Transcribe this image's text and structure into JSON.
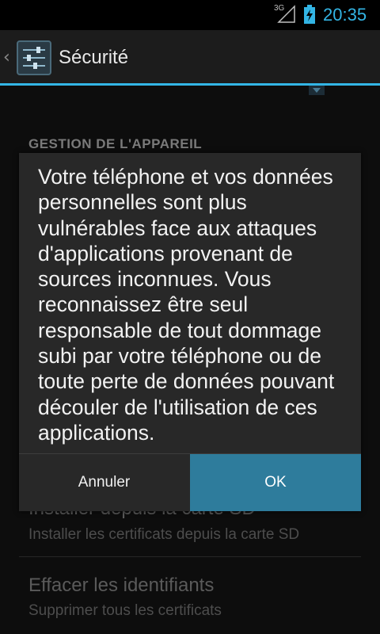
{
  "status_bar": {
    "network": "3G",
    "time": "20:35",
    "time_color": "#33b5e5"
  },
  "action_bar": {
    "title": "Sécurité",
    "accent_color": "#33b5e5",
    "icon": "settings-sliders-icon"
  },
  "settings": {
    "section_header": "GESTION DE L'APPAREIL",
    "items": [
      {
        "title": "Installer depuis la carte SD",
        "summary": "Installer les certificats depuis la carte SD"
      },
      {
        "title": "Effacer les identifiants",
        "summary": "Supprimer tous les certificats"
      }
    ]
  },
  "dialog": {
    "message": "Votre téléphone et vos données\npersonnelles sont plus\nvulnérables face aux attaques\nd'applications provenant de\nsources inconnues. Vous\nreconnaissez être seul\nresponsable de tout dommage\nsubi par votre téléphone ou de\ntoute perte de données pouvant\ndécouler de l'utilisation de ces\napplications.",
    "cancel_label": "Annuler",
    "ok_label": "OK",
    "ok_color": "#2e7c9c"
  }
}
